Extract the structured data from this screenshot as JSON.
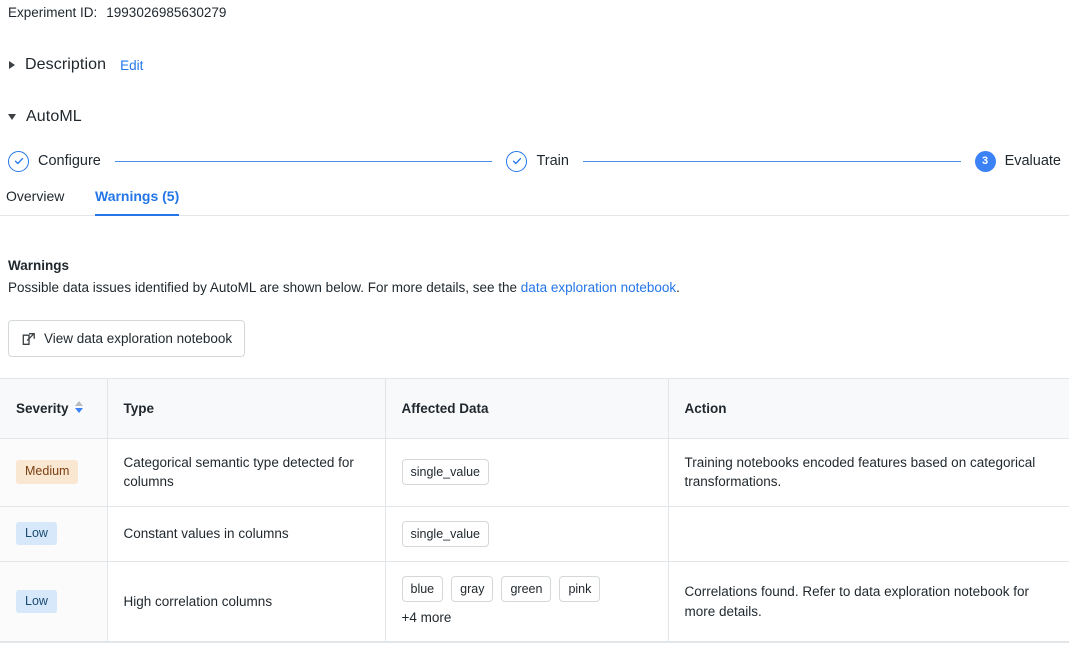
{
  "experiment": {
    "id_label": "Experiment ID:",
    "id_value": "1993026985630279"
  },
  "sections": {
    "description": {
      "title": "Description",
      "edit_label": "Edit",
      "expanded": false
    },
    "automl": {
      "title": "AutoML",
      "expanded": true
    }
  },
  "stepper": {
    "steps": [
      {
        "label": "Configure",
        "state": "done",
        "marker": "check"
      },
      {
        "label": "Train",
        "state": "done",
        "marker": "check"
      },
      {
        "label": "Evaluate",
        "state": "current",
        "marker": "3"
      }
    ],
    "line_color": "#4a90e2",
    "accent_color": "#3b82f6"
  },
  "tabs": [
    {
      "label": "Overview",
      "active": false
    },
    {
      "label": "Warnings (5)",
      "active": true
    }
  ],
  "warnings_panel": {
    "heading": "Warnings",
    "description_before": "Possible data issues identified by AutoML are shown below. For more details, see the ",
    "description_link": "data exploration notebook",
    "description_after": ".",
    "button_label": "View data exploration notebook",
    "button_icon": "external-link-icon"
  },
  "table": {
    "columns": [
      {
        "label": "Severity",
        "sortable": true,
        "sort_icon": "sort-arrows-icon"
      },
      {
        "label": "Type",
        "sortable": false
      },
      {
        "label": "Affected Data",
        "sortable": false
      },
      {
        "label": "Action",
        "sortable": false
      }
    ],
    "rows": [
      {
        "severity": "Medium",
        "severity_level": "medium",
        "type": "Categorical semantic type detected for columns",
        "chips": [
          "single_value"
        ],
        "more": "",
        "action": "Training notebooks encoded features based on categorical transformations."
      },
      {
        "severity": "Low",
        "severity_level": "low",
        "type": "Constant values in columns",
        "chips": [
          "single_value"
        ],
        "more": "",
        "action": ""
      },
      {
        "severity": "Low",
        "severity_level": "low",
        "type": "High correlation columns",
        "chips": [
          "blue",
          "gray",
          "green",
          "pink"
        ],
        "more": "+4 more",
        "action": "Correlations found. Refer to data exploration notebook for more details."
      }
    ]
  },
  "colors": {
    "accent": "#2476e8",
    "badge_medium_bg": "#fae7d2",
    "badge_medium_fg": "#7a3e11",
    "badge_low_bg": "#d6e8fa",
    "badge_low_fg": "#1b4a72",
    "border": "#e3e6e8"
  }
}
